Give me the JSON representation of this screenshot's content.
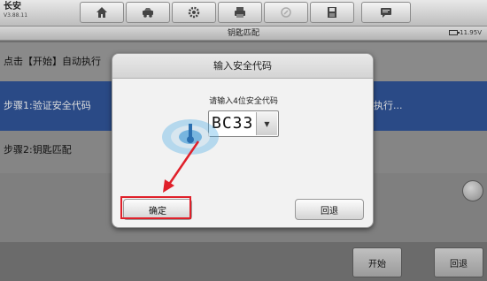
{
  "app": {
    "brand": "长安",
    "version": "V3.88.11"
  },
  "toolbar": {
    "icons": [
      "home-icon",
      "vehicle-icon",
      "settings-icon",
      "print-icon",
      "help-icon",
      "save-icon",
      "message-icon"
    ]
  },
  "title": "钥匙匹配",
  "battery": "11.95V",
  "list": {
    "row1": "点击【开始】自动执行",
    "row2": "步骤1:验证安全代码",
    "row2_right": "执行...",
    "row3": "步骤2:钥匙匹配"
  },
  "bottom": {
    "start_label": "开始",
    "back_label": "回退"
  },
  "dialog": {
    "title": "输入安全代码",
    "prompt": "请输入4位安全代码",
    "code_value": "BC33",
    "confirm_label": "确定",
    "back_label": "回退"
  },
  "colors": {
    "highlight": "#e0202a",
    "selected_row": "#2a4a86"
  }
}
